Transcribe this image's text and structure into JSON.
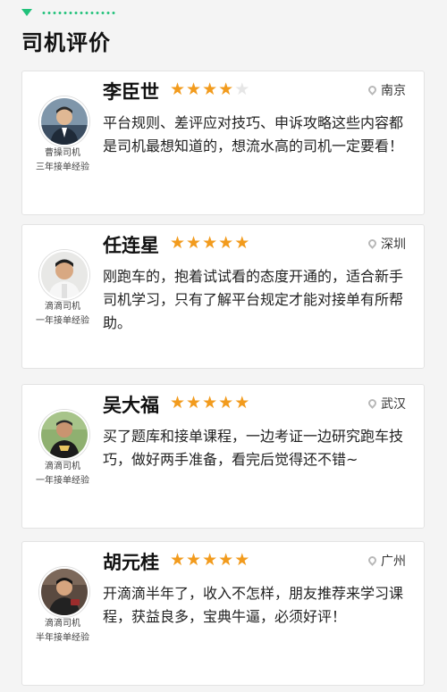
{
  "section": {
    "title": "司机评价"
  },
  "colors": {
    "accent": "#21c17a",
    "star": "#f29b1d",
    "star_empty": "#e6e6e6"
  },
  "reviews": [
    {
      "name": "李臣世",
      "rating": 4,
      "max_rating": 5,
      "location": "南京",
      "company": "曹操司机",
      "experience": "三年接单经验",
      "comment": "平台规则、差评应对技巧、申诉攻略这些内容都是司机最想知道的，想流水高的司机一定要看！"
    },
    {
      "name": "任连星",
      "rating": 5,
      "max_rating": 5,
      "location": "深圳",
      "company": "滴滴司机",
      "experience": "一年接单经验",
      "comment": "刚跑车的，抱着试试看的态度开通的，适合新手司机学习，只有了解平台规定才能对接单有所帮助。"
    },
    {
      "name": "吴大福",
      "rating": 5,
      "max_rating": 5,
      "location": "武汉",
      "company": "滴滴司机",
      "experience": "一年接单经验",
      "comment": "买了题库和接单课程，一边考证一边研究跑车技巧，做好两手准备，看完后觉得还不错~"
    },
    {
      "name": "胡元桂",
      "rating": 5,
      "max_rating": 5,
      "location": "广州",
      "company": "滴滴司机",
      "experience": "半年接单经验",
      "comment": "开滴滴半年了，收入不怎样，朋友推荐来学习课程，获益良多，宝典牛逼，必须好评！"
    }
  ]
}
